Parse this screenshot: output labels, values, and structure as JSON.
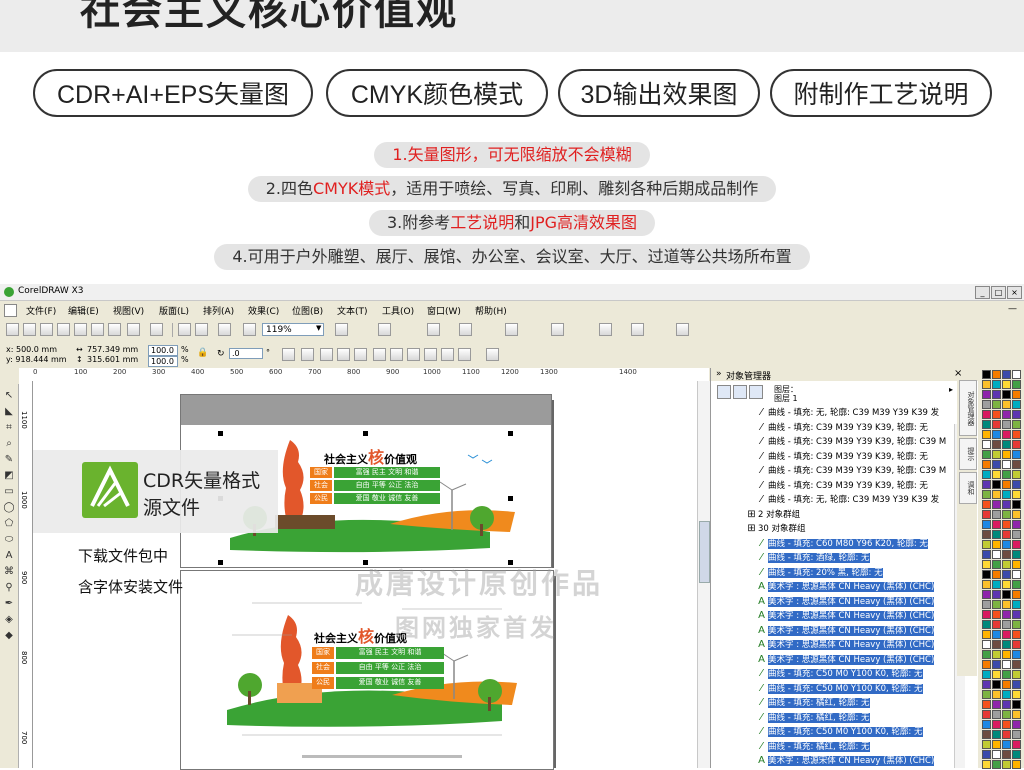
{
  "banner": {
    "title": "社会主义核心价值观"
  },
  "pills": [
    {
      "label": "CDR+AI+EPS矢量图"
    },
    {
      "label": "CMYK颜色模式"
    },
    {
      "label": "3D输出效果图"
    },
    {
      "label": "附制作工艺说明"
    }
  ],
  "features": {
    "l1": {
      "a": "1.矢量图形，可无限缩放",
      "b": "不会模糊"
    },
    "l2": {
      "a": "2.四色",
      "b": "CMYK模式",
      "c": "，适用于喷绘、写真、印刷、雕刻各种后期成品制作"
    },
    "l3": {
      "a": "3.附参考",
      "b": "工艺说明",
      "c": "和",
      "d": "JPG高清效果图"
    },
    "l4": {
      "a": "4.可用于户外雕塑、展厅、展馆、办公室、会议室、大厅、过道等公共场所布置"
    }
  },
  "app": {
    "title": "CorelDRAW X3",
    "menu": [
      "文件(F)",
      "编辑(E)",
      "视图(V)",
      "版面(L)",
      "排列(A)",
      "效果(C)",
      "位图(B)",
      "文本(T)",
      "工具(O)",
      "窗口(W)",
      "帮助(H)"
    ],
    "zoom": "119%",
    "props": {
      "x": "x: 500.0 mm",
      "y": "y: 918.444 mm",
      "w": "757.349 mm",
      "h": "315.601 mm",
      "sx": "100.0",
      "sy": "100.0",
      "pct1": "%",
      "pct2": "%",
      "rot": ".0",
      "deg": "°"
    },
    "ruler_h": [
      "0",
      "100",
      "200",
      "300",
      "400",
      "500",
      "600",
      "700",
      "800",
      "900",
      "1000",
      "1100",
      "1200",
      "1300",
      "1400"
    ],
    "ruler_v": [
      "1100",
      "1000",
      "900",
      "800",
      "700"
    ]
  },
  "object_manager": {
    "title": "对象管理器",
    "page": "图层：",
    "layer": "图层 1",
    "rows": [
      {
        "text": "曲线 - 填充: 无, 轮廓: C39 M39 Y39 K39 发",
        "sel": false,
        "icon": "curve"
      },
      {
        "text": "曲线 - 填充: C39 M39 Y39 K39, 轮廓: 无",
        "sel": false,
        "icon": "curve"
      },
      {
        "text": "曲线 - 填充: C39 M39 Y39 K39, 轮廓: C39 M",
        "sel": false,
        "icon": "curve"
      },
      {
        "text": "曲线 - 填充: C39 M39 Y39 K39, 轮廓: 无",
        "sel": false,
        "icon": "curve"
      },
      {
        "text": "曲线 - 填充: C39 M39 Y39 K39, 轮廓: C39 M",
        "sel": false,
        "icon": "curve"
      },
      {
        "text": "曲线 - 填充: C39 M39 Y39 K39, 轮廓: 无",
        "sel": false,
        "icon": "curve"
      },
      {
        "text": "曲线 - 填充: 无, 轮廓: C39 M39 Y39 K39 发",
        "sel": false,
        "icon": "curve"
      },
      {
        "text": "2 对象群组",
        "sel": false,
        "icon": "group"
      },
      {
        "text": "30 对象群组",
        "sel": false,
        "icon": "group"
      },
      {
        "text": "曲线 - 填充: C60 M80 Y96 K20, 轮廓: 无",
        "sel": true,
        "icon": "curve"
      },
      {
        "text": "曲线 - 填充: 酒绿, 轮廓: 无",
        "sel": true,
        "icon": "curve"
      },
      {
        "text": "曲线 - 填充: 20% 黑, 轮廓: 无",
        "sel": true,
        "icon": "curve"
      },
      {
        "text": "美术字 : 思源黑体 CN Heavy (黑体) (CHC)",
        "sel": true,
        "icon": "text"
      },
      {
        "text": "美术字 : 思源黑体 CN Heavy (黑体) (CHC)",
        "sel": true,
        "icon": "text"
      },
      {
        "text": "美术字 : 思源黑体 CN Heavy (黑体) (CHC)",
        "sel": true,
        "icon": "text"
      },
      {
        "text": "美术字 : 思源黑体 CN Heavy (黑体) (CHC)",
        "sel": true,
        "icon": "text"
      },
      {
        "text": "美术字 : 思源黑体 CN Heavy (黑体) (CHC)",
        "sel": true,
        "icon": "text"
      },
      {
        "text": "美术字 : 思源黑体 CN Heavy (黑体) (CHC)",
        "sel": true,
        "icon": "text"
      },
      {
        "text": "曲线 - 填充: C50 M0 Y100 K0, 轮廓: 无",
        "sel": true,
        "icon": "curve"
      },
      {
        "text": "曲线 - 填充: C50 M0 Y100 K0, 轮廓: 无",
        "sel": true,
        "icon": "curve"
      },
      {
        "text": "曲线 - 填充: 橘红, 轮廓: 无",
        "sel": true,
        "icon": "curve"
      },
      {
        "text": "曲线 - 填充: 橘红, 轮廓: 无",
        "sel": true,
        "icon": "curve"
      },
      {
        "text": "曲线 - 填充: C50 M0 Y100 K0, 轮廓: 无",
        "sel": true,
        "icon": "curve"
      },
      {
        "text": "曲线 - 填充: 橘红, 轮廓: 无",
        "sel": true,
        "icon": "curve"
      },
      {
        "text": "美术字 : 思源宋体 CN Heavy (黑体) (CHC)",
        "sel": true,
        "icon": "text"
      }
    ],
    "dock_tabs": [
      "对象管理器",
      "提示",
      "调和"
    ]
  },
  "overlay": {
    "title1": "CDR矢量格式",
    "title2": "源文件",
    "dl1": "下载文件包中",
    "dl2": "含字体安装文件"
  },
  "artwork": {
    "heading_a": "社会主义",
    "heading_core": "核",
    "heading_b": "价值观",
    "rows": [
      {
        "head": "国家",
        "items": "富强  民主  文明  和谐"
      },
      {
        "head": "社会",
        "items": "自由  平等  公正  法治"
      },
      {
        "head": "公民",
        "items": "爱国  敬业  诚信  友善"
      }
    ]
  },
  "watermark": {
    "line1": "成唐设计原创作品",
    "line2": "图网独家首发"
  },
  "colors": {
    "accent_red": "#e02020",
    "selection": "#316ac5",
    "green": "#3aa335",
    "orange": "#ef7d1a"
  }
}
